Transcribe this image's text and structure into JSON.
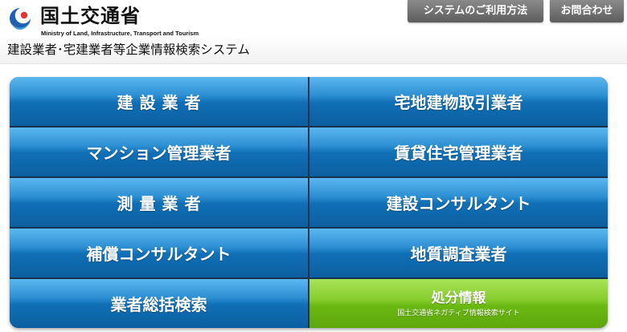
{
  "header": {
    "ministry_name_jp": "国土交通省",
    "ministry_name_en": "Ministry of Land, Infrastructure, Transport and Tourism",
    "system_title": "建設業者･宅建業者等企業情報検索システム",
    "howto_label": "システムのご利用方法",
    "contact_label": "お問合わせ"
  },
  "menu": {
    "items": [
      {
        "label": "建設業者"
      },
      {
        "label": "宅地建物取引業者"
      },
      {
        "label": "マンション管理業者"
      },
      {
        "label": "賃貸住宅管理業者"
      },
      {
        "label": "測量業者"
      },
      {
        "label": "建設コンサルタント"
      },
      {
        "label": "補償コンサルタント"
      },
      {
        "label": "地質調査業者"
      },
      {
        "label": "業者総括検索"
      },
      {
        "label": "処分情報",
        "sublabel": "国土交通省ネガティブ情報検索サイト"
      }
    ]
  },
  "colors": {
    "tile_blue": "#106fb6",
    "tile_green": "#6bb812",
    "header_button": "#6e6e6e"
  }
}
